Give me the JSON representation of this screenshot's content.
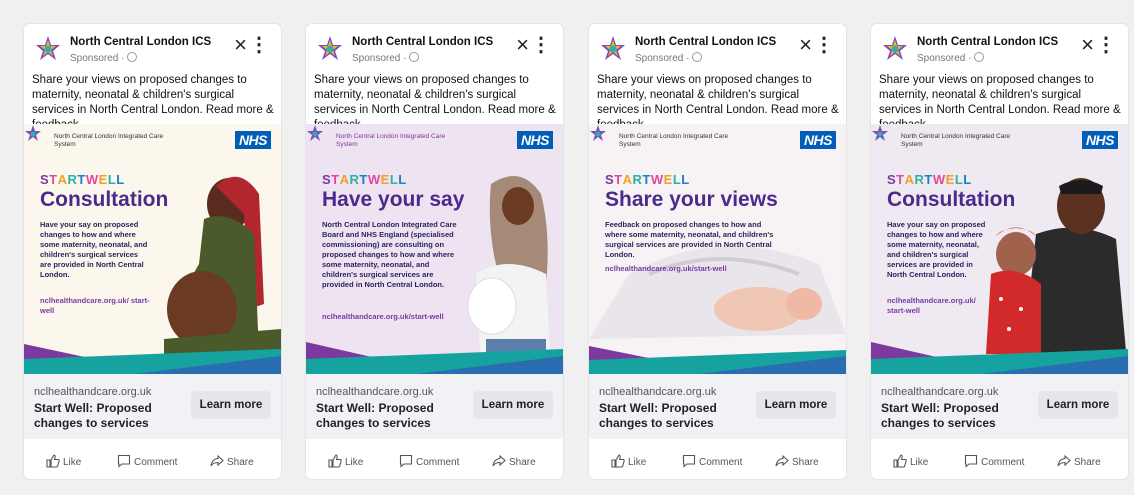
{
  "colors": {
    "nhs_blue": "#005EB8",
    "purple": "#4b2a8c",
    "teal": "#16a3a0",
    "magenta": "#a13fa6"
  },
  "cards": [
    {
      "page_name": "North Central London ICS",
      "sponsored": "Sponsored ·",
      "text": "Share your views on proposed changes to maternity, neonatal & children's surgical services in North Central London. Read more & feedback.",
      "ics_name": "North Central London Integrated Care System",
      "nhs": "NHS",
      "start_well": "START WELL",
      "headline": "Consultation",
      "body": "Have your say on proposed changes to how and where some maternity, neonatal, and children's surgical services are provided in North Central London.",
      "link": "nclhealthandcare.org.uk/ start-well",
      "domain": "nclhealthandcare.org.uk",
      "footer_title": "Start Well: Proposed changes to services",
      "cta": "Learn more",
      "like": "Like",
      "comment": "Comment",
      "share": "Share"
    },
    {
      "page_name": "North Central London ICS",
      "sponsored": "Sponsored ·",
      "text": "Share your views on proposed changes to maternity, neonatal & children's surgical services in North Central London. Read more & feedback.",
      "ics_name": "North Central London Integrated Care System",
      "nhs": "NHS",
      "start_well": "START WELL",
      "headline": "Have your say",
      "body": "North Central London Integrated Care Board and NHS England (specialised commissioning) are consulting on proposed changes to how and where some maternity, neonatal, and children's surgical services are provided in North Central London.",
      "link": "nclhealthandcare.org.uk/start-well",
      "domain": "nclhealthandcare.org.uk",
      "footer_title": "Start Well: Proposed changes to services",
      "cta": "Learn more",
      "like": "Like",
      "comment": "Comment",
      "share": "Share"
    },
    {
      "page_name": "North Central London ICS",
      "sponsored": "Sponsored ·",
      "text": "Share your views on proposed changes to maternity, neonatal & children's surgical services in North Central London. Read more & feedback.",
      "ics_name": "North Central London Integrated Care System",
      "nhs": "NHS",
      "start_well": "START WELL",
      "headline": "Share your views",
      "body": "Feedback on proposed changes to how and where some maternity, neonatal, and children's surgical services are provided in North Central London.",
      "link": "nclhealthandcare.org.uk/start-well",
      "domain": "nclhealthandcare.org.uk",
      "footer_title": "Start Well: Proposed changes to services",
      "cta": "Learn more",
      "like": "Like",
      "comment": "Comment",
      "share": "Share"
    },
    {
      "page_name": "North Central London ICS",
      "sponsored": "Sponsored ·",
      "text": "Share your views on proposed changes to maternity, neonatal & children's surgical services in North Central London. Read more & feedback.",
      "ics_name": "North Central London Integrated Care System",
      "nhs": "NHS",
      "start_well": "START WELL",
      "headline": "Consultation",
      "body": "Have your say on proposed changes to how and where some maternity, neonatal, and children's surgical services are provided in North Central London.",
      "link": "nclhealthandcare.org.uk/ start-well",
      "domain": "nclhealthandcare.org.uk",
      "footer_title": "Start Well: Proposed changes to services",
      "cta": "Learn more",
      "like": "Like",
      "comment": "Comment",
      "share": "Share"
    }
  ]
}
